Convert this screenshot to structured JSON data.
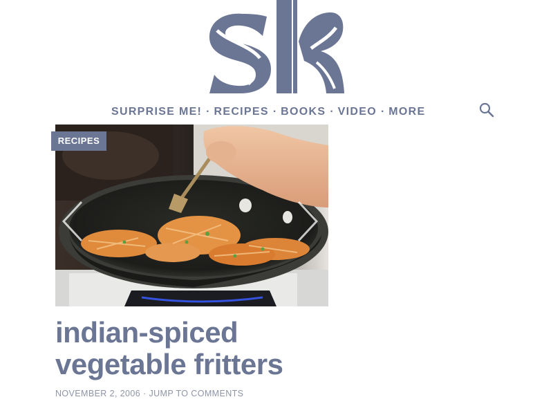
{
  "brand": {
    "logo_text": "sk",
    "accent_color": "#6b7594"
  },
  "nav": {
    "items": [
      {
        "label": "SURPRISE ME!"
      },
      {
        "label": "RECIPES"
      },
      {
        "label": "BOOKS"
      },
      {
        "label": "VIDEO"
      },
      {
        "label": "MORE"
      }
    ],
    "separator": "·",
    "search_icon": "search-icon"
  },
  "hero": {
    "category_badge": "RECIPES",
    "image_subject": "",
    "prev_icon": "chevron-left-icon",
    "next_icon": "chevron-right-icon"
  },
  "post": {
    "title_line1": "indian-spiced",
    "title_line2": "vegetable fritters",
    "date": "NOVEMBER 2, 2006",
    "meta_separator": "·",
    "comments_link": "JUMP TO COMMENTS"
  }
}
